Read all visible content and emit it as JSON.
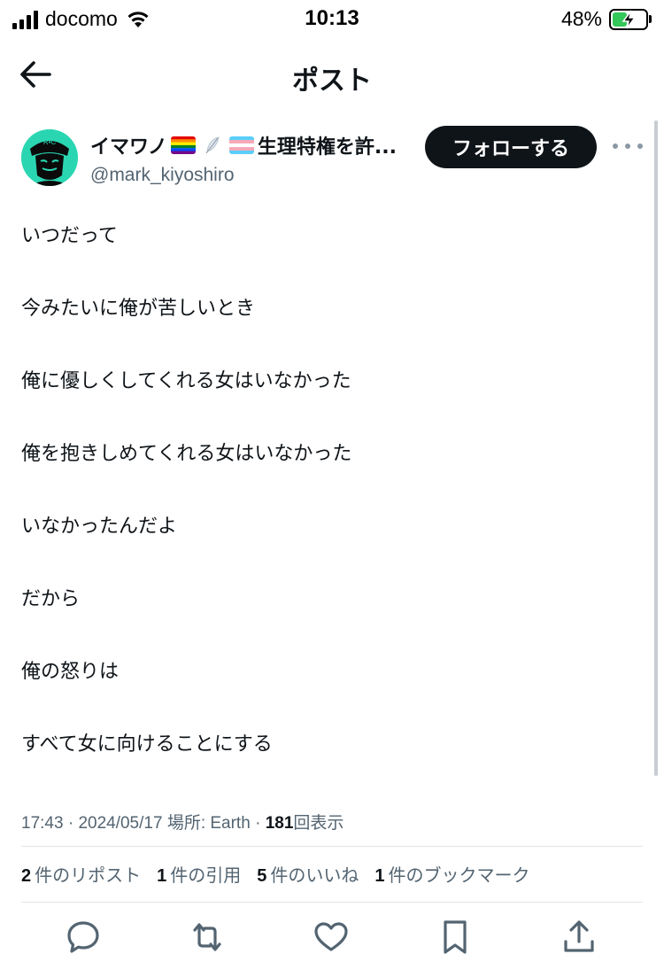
{
  "status_bar": {
    "carrier": "docomo",
    "time": "10:13",
    "battery_percent": "48%",
    "battery_level": 0.48,
    "charging": true
  },
  "header": {
    "title": "ポスト",
    "back_icon": "arrow-left-icon"
  },
  "author": {
    "display_name_start": "イマワノ",
    "display_name_end": "生理特権を許...",
    "handle": "@mark_kiyoshiro",
    "avatar_text": "R•C",
    "follow_label": "フォローする",
    "more_icon": "more-icon"
  },
  "tweet": {
    "lines": [
      "いつだって",
      "今みたいに俺が苦しいとき",
      "俺に優しくしてくれる女はいなかった",
      "俺を抱きしめてくれる女はいなかった",
      "いなかったんだよ",
      "だから",
      "俺の怒りは",
      "すべて女に向けることにする"
    ]
  },
  "meta": {
    "time": "17:43",
    "date": "2024/05/17",
    "location": "場所: Earth",
    "views_count": "181",
    "views_label": "回表示"
  },
  "stats": [
    {
      "count": "2",
      "label": "件のリポスト"
    },
    {
      "count": "1",
      "label": "件の引用"
    },
    {
      "count": "5",
      "label": "件のいいね"
    },
    {
      "count": "1",
      "label": "件のブックマーク"
    }
  ],
  "actions": [
    "reply-icon",
    "repost-icon",
    "like-icon",
    "bookmark-icon",
    "share-icon"
  ],
  "colors": {
    "text": "#0f1419",
    "secondary": "#536471",
    "follow_bg": "#0f1419",
    "avatar_bg": "#2ad6b2",
    "battery_fill": "#34c759"
  }
}
